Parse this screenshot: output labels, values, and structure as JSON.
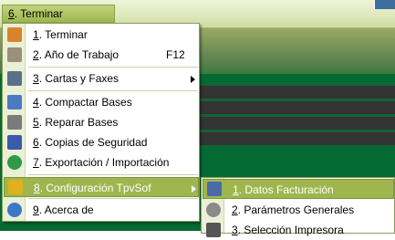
{
  "menubar": {
    "num": "6",
    "label": ". Terminar"
  },
  "menu": {
    "items": [
      {
        "num": "1",
        "label": ". Terminar",
        "shortcut": "",
        "icon": "power-icon",
        "color": "#d9842b"
      },
      {
        "num": "2",
        "label": ". Año de Trabajo",
        "shortcut": "F12",
        "icon": "calendar-icon",
        "color": "#9a8f7a"
      },
      {
        "num": "3",
        "label": ". Cartas y Faxes",
        "shortcut": "",
        "icon": "fax-icon",
        "color": "#5a6f8a"
      },
      {
        "num": "4",
        "label": ". Compactar Bases",
        "shortcut": "",
        "icon": "compact-icon",
        "color": "#4b7bbf"
      },
      {
        "num": "5",
        "label": ". Reparar Bases",
        "shortcut": "",
        "icon": "tools-icon",
        "color": "#7b7b7b"
      },
      {
        "num": "6",
        "label": ". Copias de Seguridad",
        "shortcut": "",
        "icon": "floppy-icon",
        "color": "#3b5aa8"
      },
      {
        "num": "7",
        "label": ". Exportación / Importación",
        "shortcut": "",
        "icon": "globe-icon",
        "color": "#2f9a4a"
      },
      {
        "num": "8",
        "label": ". Configuración TpvSof",
        "shortcut": "",
        "icon": "config-icon",
        "color": "#e0b020"
      },
      {
        "num": "9",
        "label": ". Acerca de",
        "shortcut": "",
        "icon": "help-icon",
        "color": "#3c78c8"
      }
    ]
  },
  "submenu": {
    "items": [
      {
        "num": "1",
        "label": ". Datos Facturación",
        "icon": "user-card-icon",
        "color": "#4a6aa8"
      },
      {
        "num": "2",
        "label": ". Parámetros Generales",
        "icon": "gear-icon",
        "color": "#8a8a8a"
      },
      {
        "num": "3",
        "label": ". Selección Impresora",
        "icon": "printer-icon",
        "color": "#555555"
      }
    ]
  }
}
